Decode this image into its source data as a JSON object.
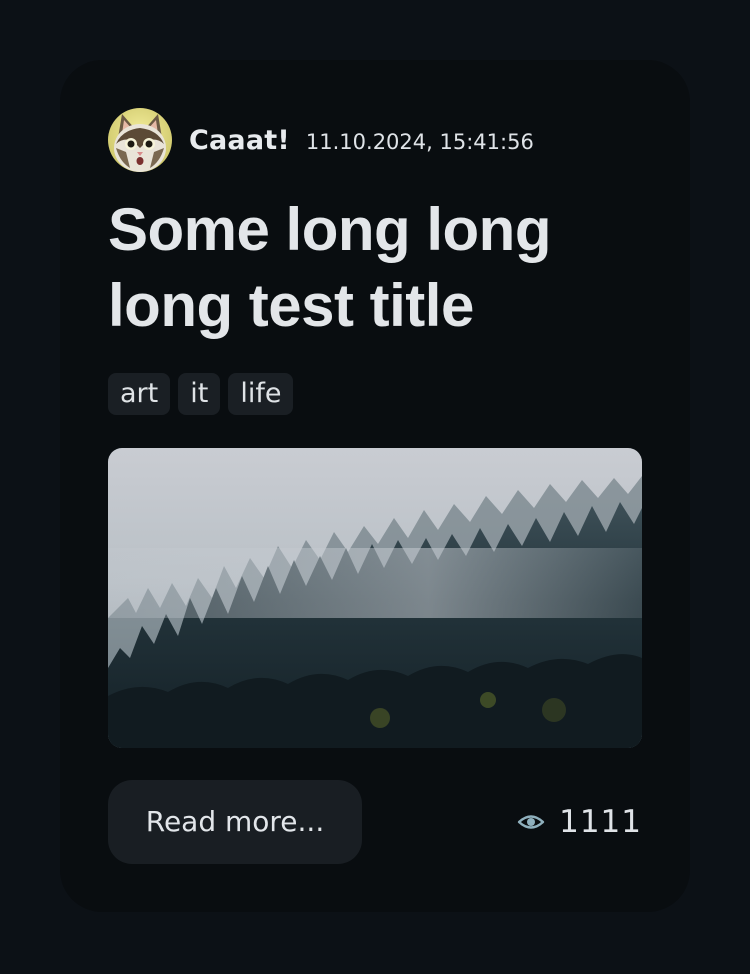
{
  "post": {
    "author": "Caaat!",
    "date": "11.10.2024, 15:41:56",
    "title": "Some long long long test title",
    "tags": [
      "art",
      "it",
      "life"
    ],
    "read_more_label": "Read more...",
    "views": "1111"
  },
  "icons": {
    "avatar": "cat-avatar",
    "views": "eye-icon"
  },
  "colors": {
    "page_bg": "#0c1116",
    "card_bg": "#090d10",
    "tag_bg": "#1a1f24",
    "button_bg": "#191e23",
    "text": "#e3e6e9",
    "eye_icon": "#8fb0bd"
  }
}
